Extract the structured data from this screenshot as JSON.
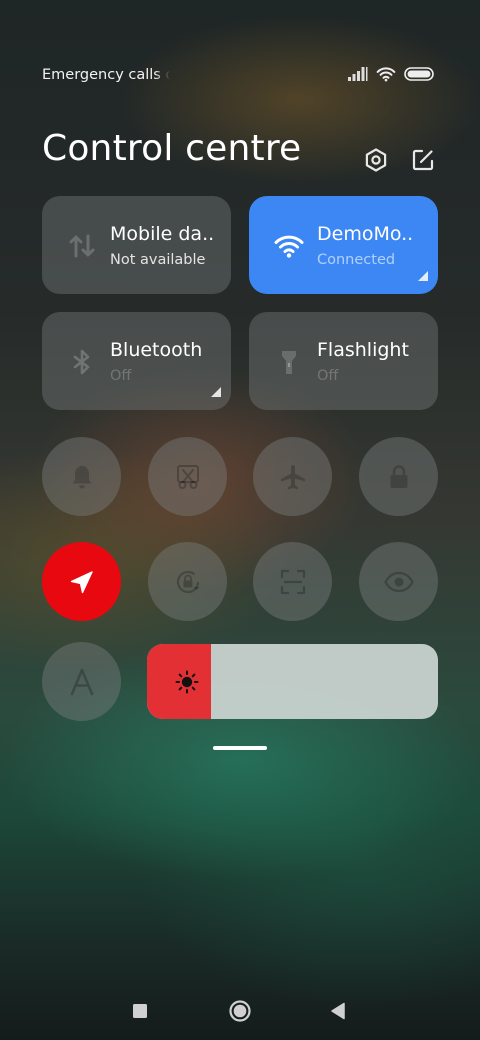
{
  "status": {
    "text": "Emergency calls only"
  },
  "header": {
    "title": "Control centre"
  },
  "tiles": [
    {
      "name": "Mobile da..",
      "sub": "Not available"
    },
    {
      "name": "DemoMo..",
      "sub": "Connected"
    },
    {
      "name": "Bluetooth",
      "sub": "Off"
    },
    {
      "name": "Flashlight",
      "sub": "Off"
    }
  ],
  "toggles_row1": [
    "bell-icon",
    "screenshot-icon",
    "airplane-icon",
    "lock-icon"
  ],
  "toggles_row2": [
    "location-icon",
    "rotation-lock-icon",
    "scanner-icon",
    "eye-icon"
  ],
  "brightness": {
    "level": 0.22
  },
  "colors": {
    "accent": "#3d87f5",
    "location": "#e8080f",
    "brightness": "#e23034"
  }
}
